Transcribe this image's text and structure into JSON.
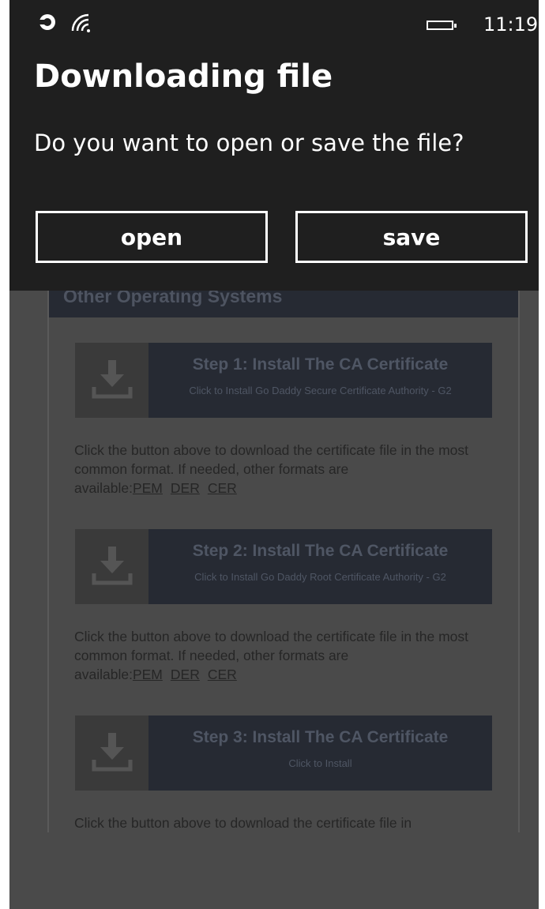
{
  "status_bar": {
    "time": "11:19"
  },
  "dialog": {
    "title": "Downloading file",
    "message": "Do you want to open or save the file?",
    "open_label": "open",
    "save_label": "save"
  },
  "page": {
    "section_title": "Other Operating Systems",
    "steps": [
      {
        "title": "Step 1: Install The CA Certificate",
        "subtitle": "Click to Install Go Daddy Secure Certificate Authority - G2"
      },
      {
        "title": "Step 2: Install The CA Certificate",
        "subtitle": "Click to Install Go Daddy Root Certificate Authority - G2"
      },
      {
        "title": "Step 3: Install The CA Certificate",
        "subtitle": "Click to Install"
      }
    ],
    "para_text": "Click the button above to download the certificate file in the most common format. If needed, other formats are available:",
    "para_text_partial": "Click the button above to download the certificate file in",
    "formats": [
      "PEM",
      "DER",
      "CER"
    ]
  },
  "colors": {
    "dialog_bg": "#1f1f1f",
    "overlay_bg": "#4a4a4a",
    "step_bg": "#262a33"
  }
}
